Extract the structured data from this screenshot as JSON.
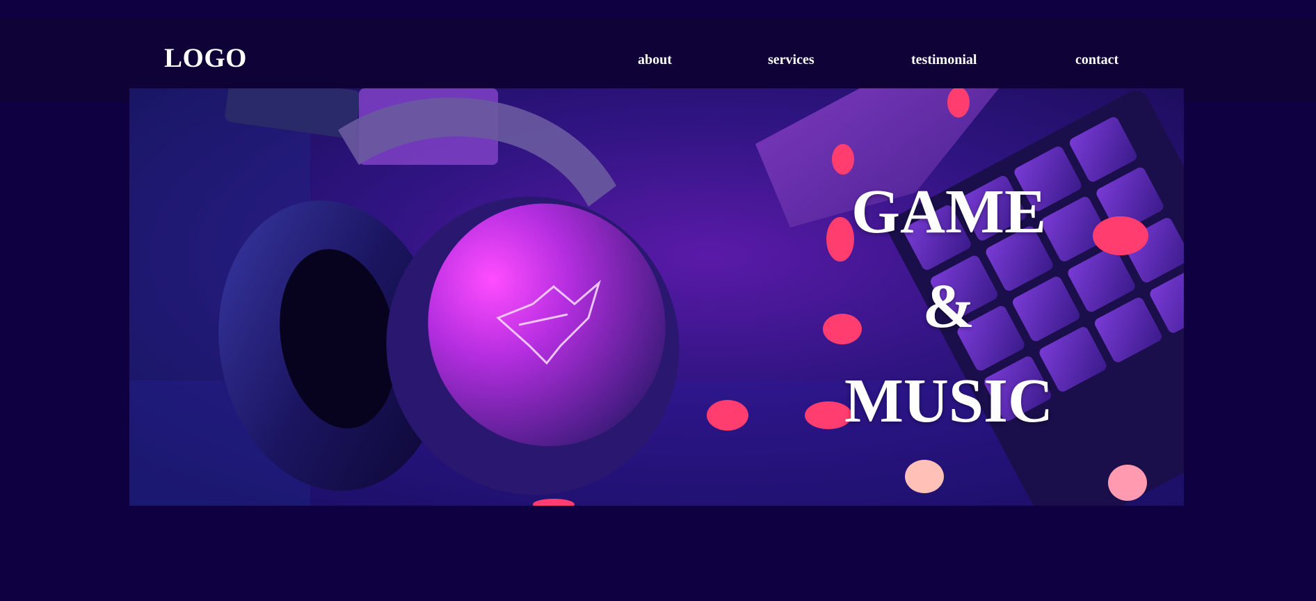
{
  "header": {
    "logo": "LOGO",
    "nav": [
      {
        "label": "about"
      },
      {
        "label": "services"
      },
      {
        "label": "testimonial"
      },
      {
        "label": "contact"
      }
    ]
  },
  "hero": {
    "image": "gaming-headset-keyboard-photo",
    "title_lines": [
      "GAME",
      "&",
      "MUSIC"
    ]
  },
  "colors": {
    "page_background": "#0f0042",
    "header_background": "#0f0237",
    "text": "#ffffff"
  }
}
